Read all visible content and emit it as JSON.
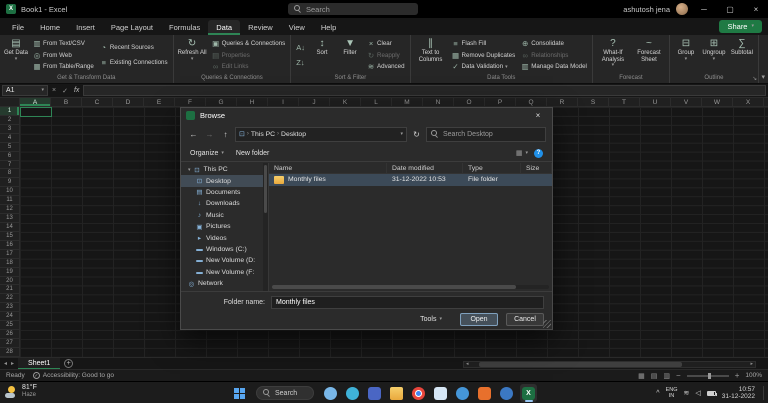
{
  "titlebar": {
    "title": "Book1 - Excel",
    "search_placeholder": "Search",
    "user_name": "ashutosh jena"
  },
  "ribbon": {
    "tabs": [
      "File",
      "Home",
      "Insert",
      "Page Layout",
      "Formulas",
      "Data",
      "Review",
      "View",
      "Help"
    ],
    "active_tab": "Data",
    "share_label": "Share",
    "groups": [
      {
        "label": "Get & Transform Data",
        "items": [
          {
            "type": "big",
            "label": "Get Data",
            "icon": "get-data",
            "dropdown": true
          },
          {
            "type": "col",
            "items": [
              {
                "label": "From Text/CSV",
                "icon": "text-csv"
              },
              {
                "label": "From Web",
                "icon": "web"
              },
              {
                "label": "From Table/Range",
                "icon": "table"
              }
            ]
          },
          {
            "type": "col",
            "items": [
              {
                "label": "Recent Sources",
                "icon": "recent"
              },
              {
                "label": "Existing Connections",
                "icon": "connections"
              }
            ]
          }
        ]
      },
      {
        "label": "Queries & Connections",
        "items": [
          {
            "type": "big",
            "label": "Refresh All",
            "icon": "refresh",
            "dropdown": true
          },
          {
            "type": "col",
            "items": [
              {
                "label": "Queries & Connections",
                "icon": "queries"
              },
              {
                "label": "Properties",
                "icon": "properties",
                "disabled": true
              },
              {
                "label": "Edit Links",
                "icon": "links",
                "disabled": true
              }
            ]
          }
        ]
      },
      {
        "label": "Sort & Filter",
        "items": [
          {
            "type": "col",
            "items": [
              {
                "label": "",
                "icon": "az"
              },
              {
                "label": "",
                "icon": "za"
              }
            ]
          },
          {
            "type": "big",
            "label": "Sort",
            "icon": "sort"
          },
          {
            "type": "big",
            "label": "Filter",
            "icon": "filter"
          },
          {
            "type": "col",
            "items": [
              {
                "label": "Clear",
                "icon": "clear"
              },
              {
                "label": "Reapply",
                "icon": "reapply",
                "disabled": true
              },
              {
                "label": "Advanced",
                "icon": "advanced"
              }
            ]
          }
        ]
      },
      {
        "label": "Data Tools",
        "items": [
          {
            "type": "big",
            "label": "Text to Columns",
            "icon": "text-columns"
          },
          {
            "type": "col",
            "items": [
              {
                "label": "Flash Fill",
                "icon": "flash"
              },
              {
                "label": "Remove Duplicates",
                "icon": "remove-dup"
              },
              {
                "label": "Data Validation",
                "icon": "validation",
                "dropdown": true
              }
            ]
          },
          {
            "type": "col",
            "items": [
              {
                "label": "Consolidate",
                "icon": "consolidate"
              },
              {
                "label": "Relationships",
                "icon": "relationships",
                "disabled": true
              },
              {
                "label": "Manage Data Model",
                "icon": "data-model"
              }
            ]
          }
        ]
      },
      {
        "label": "Forecast",
        "items": [
          {
            "type": "big",
            "label": "What-If Analysis",
            "icon": "what-if",
            "dropdown": true
          },
          {
            "type": "big",
            "label": "Forecast Sheet",
            "icon": "forecast"
          }
        ]
      },
      {
        "label": "Outline",
        "launcher": true,
        "items": [
          {
            "type": "big",
            "label": "Group",
            "icon": "group",
            "dropdown": true
          },
          {
            "type": "big",
            "label": "Ungroup",
            "icon": "ungroup",
            "dropdown": true
          },
          {
            "type": "big",
            "label": "Subtotal",
            "icon": "subtotal"
          }
        ]
      }
    ]
  },
  "formula_bar": {
    "name_box": "A1",
    "fx_label": "fx"
  },
  "grid": {
    "columns": [
      "A",
      "B",
      "C",
      "D",
      "E",
      "F",
      "G",
      "H",
      "I",
      "J",
      "K",
      "L",
      "M",
      "N",
      "O",
      "P",
      "Q",
      "R",
      "S",
      "T",
      "U",
      "V",
      "W",
      "X"
    ],
    "row_count": 28,
    "selected_col": "A",
    "selected_row": 1
  },
  "sheet_bar": {
    "tabs": [
      {
        "label": "Sheet1",
        "active": true
      }
    ]
  },
  "status_bar": {
    "ready_label": "Ready",
    "accessibility_label": "Accessibility: Good to go",
    "zoom_level": "100%"
  },
  "dialog": {
    "title": "Browse",
    "breadcrumb": [
      "This PC",
      "Desktop"
    ],
    "search_placeholder": "Search Desktop",
    "organize_label": "Organize",
    "new_folder_label": "New folder",
    "sidebar": [
      {
        "label": "This PC",
        "icon": "pc",
        "expand": true
      },
      {
        "label": "Desktop",
        "icon": "desktop",
        "child": true,
        "selected": true
      },
      {
        "label": "Documents",
        "icon": "documents",
        "child": true
      },
      {
        "label": "Downloads",
        "icon": "downloads",
        "child": true
      },
      {
        "label": "Music",
        "icon": "music",
        "child": true
      },
      {
        "label": "Pictures",
        "icon": "pictures",
        "child": true
      },
      {
        "label": "Videos",
        "icon": "videos",
        "child": true
      },
      {
        "label": "Windows (C:)",
        "icon": "drive",
        "child": true
      },
      {
        "label": "New Volume (D:",
        "icon": "drive",
        "child": true
      },
      {
        "label": "New Volume (F:",
        "icon": "drive",
        "child": true
      },
      {
        "label": "Network",
        "icon": "network"
      }
    ],
    "list": {
      "headers": [
        "Name",
        "Date modified",
        "Type",
        "Size"
      ],
      "rows": [
        {
          "name": "Monthly files",
          "date_modified": "31-12-2022 10:53",
          "type": "File folder",
          "size": "",
          "selected": true
        }
      ]
    },
    "footer": {
      "folder_name_label": "Folder name:",
      "folder_name_value": "Monthly files",
      "tools_label": "Tools",
      "open_label": "Open",
      "cancel_label": "Cancel"
    }
  },
  "taskbar": {
    "weather_temp": "81°F",
    "weather_condition": "Haze",
    "search_label": "Search",
    "apps": [
      {
        "name": "mail",
        "color": "#79b7e8"
      },
      {
        "name": "edge",
        "color": "#3fb2d8"
      },
      {
        "name": "word",
        "color": "#4a66c4"
      },
      {
        "name": "explorer",
        "color": "#f3c04a"
      },
      {
        "name": "chrome",
        "color": "#e8453c"
      },
      {
        "name": "store",
        "color": "#d6e6f5"
      },
      {
        "name": "skype",
        "color": "#4596d8"
      },
      {
        "name": "firefox",
        "color": "#e8702c"
      },
      {
        "name": "onedrive",
        "color": "#3b78c3"
      },
      {
        "name": "excel",
        "color": "#1d6f42",
        "active": true,
        "glyph": "X"
      }
    ],
    "tray": {
      "lang_line1": "ENG",
      "lang_line2": "IN",
      "time": "10:57",
      "date": "31-12-2022"
    }
  }
}
